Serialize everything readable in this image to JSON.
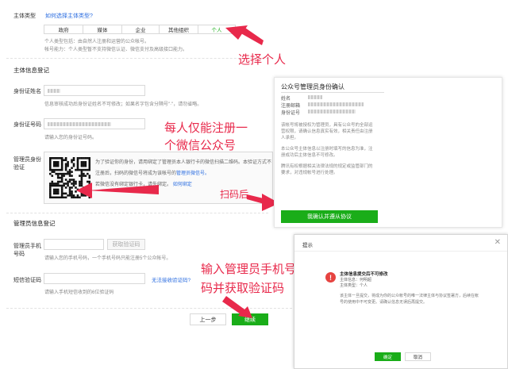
{
  "form": {
    "subject_type": {
      "label": "主体类型",
      "link": "如何选择主体类型?",
      "options": [
        "政府",
        "媒体",
        "企业",
        "其他组织",
        "个人"
      ],
      "selected": "个人",
      "note1": "个人类型包括：由自然人注册和运营的公众帐号。",
      "note2": "帐号能力：个人类型暂不支持微信认证、微信支付及高级接口能力。"
    },
    "info_section": "主体信息登记",
    "id_name": {
      "label": "身份证姓名",
      "hint": "信息审核成功后身份证姓名不可修改；如果名字包含分隔号\"·\"，请勿省略。"
    },
    "id_number": {
      "label": "身份证号码",
      "hint": "请输入您的身份证号码。"
    },
    "admin_verify": {
      "label_line1": "管理员身份",
      "label_line2": "验证",
      "text1": "为了验证你的身份，请用绑定了管理员本人银行卡的微信扫描二维码。本验证方式不",
      "text2": "注册后，扫码的微信号将成为该帐号的",
      "text2_link": "管理员微信号。",
      "text3": "若微信没有绑定银行卡，请先绑定。",
      "text3_link": "如何绑定"
    },
    "admin_section": "管理员信息登记",
    "phone": {
      "label_line1": "管理员手机",
      "label_line2": "号码",
      "button": "获取验证码",
      "hint": "请输入您的手机号码，一个手机号码只能注册5个公众帐号。"
    },
    "sms": {
      "label": "短信验证码",
      "link": "无法接收验证码?",
      "hint": "请输入手机短信收到的6位验证码"
    },
    "prev_button": "上一步",
    "next_button": "继续"
  },
  "annotations": {
    "choose_personal": "选择个人",
    "one_account_line1": "每人仅能注册一",
    "one_account_line2": "个微信公众号",
    "scan": "扫码后",
    "input_phone_line1": "输入管理员手机号",
    "input_phone_line2": "码并获取验证码"
  },
  "confirm_panel": {
    "title": "公众号管理员身份确认",
    "name_label": "姓名",
    "email_label": "注册邮箱",
    "id_label": "身份证号",
    "bullets": [
      "该帐号将被授权为管理员，具有公众号的全部运营权限，请确认信息真实有效，相关责任由注册人承担。",
      "本公众号主体信息以注册时填写的信息为准，注册成功后主体信息不可修改。",
      "腾讯有权根据相关法律法规的规定或监管部门的要求，对违规帐号进行处理。"
    ],
    "confirm_button": "我确认并遵从协议"
  },
  "dialog": {
    "title": "提示",
    "heading": "主体信息提交后不可修改",
    "line1": "主体信息：何明超",
    "line2": "主体类型：个人",
    "body": "该主体一旦提交，将成为你的公众帐号的唯一法律主体与协议签署方，后续在帐号的使用中不可变更。请确认信息无误后再提交。",
    "ok_button": "确定",
    "cancel_button": "取消"
  },
  "colors": {
    "accent": "#1aad19",
    "link": "#2b6de0",
    "annotation": "#e8294b",
    "alert": "#e64340"
  }
}
